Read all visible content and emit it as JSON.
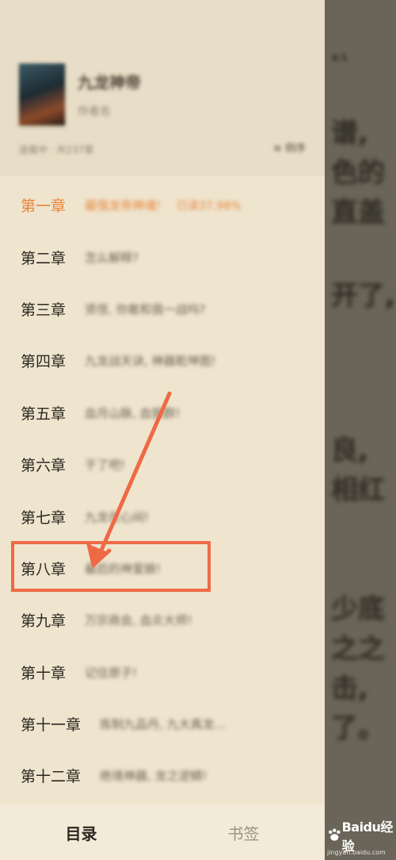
{
  "book": {
    "title": "九龙神帝",
    "author": "作者名",
    "status": "连载中 · 共237章",
    "sort_label": "≡ 倒序"
  },
  "chapters": [
    {
      "num": "第一章",
      "title": "最强龙帝神魂!",
      "progress": "已读37.98%",
      "current": true
    },
    {
      "num": "第二章",
      "title": "怎么解释?"
    },
    {
      "num": "第三章",
      "title": "贤侄, 你敢和我一战吗?"
    },
    {
      "num": "第四章",
      "title": "九龙战天诀, 神器乾坤图!"
    },
    {
      "num": "第五章",
      "title": "血月山脉, 血狼群!"
    },
    {
      "num": "第六章",
      "title": "于了吧!"
    },
    {
      "num": "第七章",
      "title": "九龙在心间!"
    },
    {
      "num": "第八章",
      "title": "最后的神爱娘!"
    },
    {
      "num": "第九章",
      "title": "万宗商会, 血炎大师!"
    },
    {
      "num": "第十章",
      "title": "记住原子!"
    },
    {
      "num": "第十一章",
      "title": "炼制九品丹, 九大真龙..."
    },
    {
      "num": "第十二章",
      "title": "绝境神器, 龙之逆鳞!"
    }
  ],
  "tabs": {
    "contents": "目录",
    "bookmarks": "书签"
  },
  "reader_text": [
    "谱,",
    "色的",
    "直盖",
    "开了,",
    "良,",
    "相红",
    "少底",
    "之之",
    "击,",
    "了。"
  ],
  "watermark": {
    "brand": "Baidu经验",
    "url": "jingyan.baidu.com"
  },
  "colors": {
    "accent": "#e8853a",
    "annotation": "#ee6a45",
    "drawer_bg": "#efe4ce"
  }
}
